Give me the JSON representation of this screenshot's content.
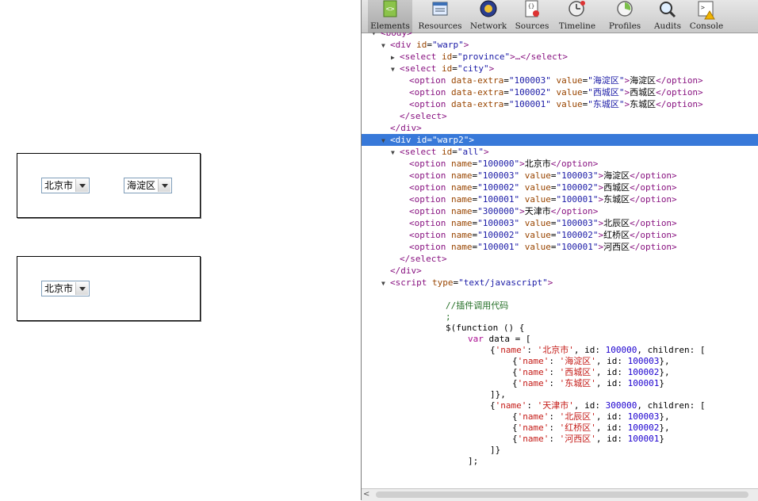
{
  "page": {
    "select1_value": "北京市",
    "select2_value": "海淀区",
    "select3_value": "北京市"
  },
  "devtools": {
    "tabs": [
      "Elements",
      "Resources",
      "Network",
      "Sources",
      "Timeline",
      "Profiles",
      "Audits",
      "Console"
    ],
    "tab_icons": [
      "elements-icon",
      "resources-icon",
      "network-icon",
      "sources-icon",
      "timeline-icon",
      "profiles-icon",
      "audits-icon",
      "console-icon"
    ],
    "active_tab": "Elements"
  },
  "dom_tree": [
    {
      "indent": 0,
      "tri": "▾",
      "kind": "tag",
      "open": "<body>"
    },
    {
      "indent": 1,
      "tri": "▼",
      "kind": "tag",
      "tag": "div",
      "attrs": [
        [
          "id",
          "warp"
        ]
      ],
      "end": ">"
    },
    {
      "indent": 2,
      "tri": "▶",
      "kind": "collapsed",
      "tag": "select",
      "attrs": [
        [
          "id",
          "province"
        ]
      ],
      "rest": ">…</select>"
    },
    {
      "indent": 2,
      "tri": "▼",
      "kind": "tag",
      "tag": "select",
      "attrs": [
        [
          "id",
          "city"
        ]
      ],
      "end": ">"
    },
    {
      "indent": 3,
      "tri": "",
      "kind": "elem",
      "tag": "option",
      "attrs": [
        [
          "data-extra",
          "100003"
        ],
        [
          "value",
          "海淀区"
        ]
      ],
      "text": "海淀区"
    },
    {
      "indent": 3,
      "tri": "",
      "kind": "elem",
      "tag": "option",
      "attrs": [
        [
          "data-extra",
          "100002"
        ],
        [
          "value",
          "西城区"
        ]
      ],
      "text": "西城区"
    },
    {
      "indent": 3,
      "tri": "",
      "kind": "elem",
      "tag": "option",
      "attrs": [
        [
          "data-extra",
          "100001"
        ],
        [
          "value",
          "东城区"
        ]
      ],
      "text": "东城区"
    },
    {
      "indent": 2,
      "tri": "",
      "kind": "close",
      "tag": "select"
    },
    {
      "indent": 1,
      "tri": "",
      "kind": "close",
      "tag": "div"
    },
    {
      "indent": 1,
      "tri": "▼",
      "kind": "tag",
      "tag": "div",
      "attrs": [
        [
          "id",
          "warp2"
        ]
      ],
      "end": ">",
      "selected": true
    },
    {
      "indent": 2,
      "tri": "▼",
      "kind": "tag",
      "tag": "select",
      "attrs": [
        [
          "id",
          "all"
        ]
      ],
      "end": ">"
    },
    {
      "indent": 3,
      "tri": "",
      "kind": "elem",
      "tag": "option",
      "attrs": [
        [
          "name",
          "100000"
        ]
      ],
      "text": "北京市"
    },
    {
      "indent": 3,
      "tri": "",
      "kind": "elem",
      "tag": "option",
      "attrs": [
        [
          "name",
          "100003"
        ],
        [
          "value",
          "100003"
        ]
      ],
      "text": "海淀区"
    },
    {
      "indent": 3,
      "tri": "",
      "kind": "elem",
      "tag": "option",
      "attrs": [
        [
          "name",
          "100002"
        ],
        [
          "value",
          "100002"
        ]
      ],
      "text": "西城区"
    },
    {
      "indent": 3,
      "tri": "",
      "kind": "elem",
      "tag": "option",
      "attrs": [
        [
          "name",
          "100001"
        ],
        [
          "value",
          "100001"
        ]
      ],
      "text": "东城区"
    },
    {
      "indent": 3,
      "tri": "",
      "kind": "elem",
      "tag": "option",
      "attrs": [
        [
          "name",
          "300000"
        ]
      ],
      "text": "天津市"
    },
    {
      "indent": 3,
      "tri": "",
      "kind": "elem",
      "tag": "option",
      "attrs": [
        [
          "name",
          "100003"
        ],
        [
          "value",
          "100003"
        ]
      ],
      "text": "北辰区"
    },
    {
      "indent": 3,
      "tri": "",
      "kind": "elem",
      "tag": "option",
      "attrs": [
        [
          "name",
          "100002"
        ],
        [
          "value",
          "100002"
        ]
      ],
      "text": "红桥区"
    },
    {
      "indent": 3,
      "tri": "",
      "kind": "elem",
      "tag": "option",
      "attrs": [
        [
          "name",
          "100001"
        ],
        [
          "value",
          "100001"
        ]
      ],
      "text": "河西区"
    },
    {
      "indent": 2,
      "tri": "",
      "kind": "close",
      "tag": "select"
    },
    {
      "indent": 1,
      "tri": "",
      "kind": "close",
      "tag": "div"
    },
    {
      "indent": 1,
      "tri": "▼",
      "kind": "tag",
      "tag": "script",
      "attrs": [
        [
          "type",
          "text/javascript"
        ]
      ],
      "end": ">"
    }
  ],
  "script_lines": [
    {
      "indent": 6,
      "parts": [
        [
          "cm",
          "//插件调用代码"
        ]
      ]
    },
    {
      "indent": 6,
      "parts": [
        [
          "cm",
          ";"
        ]
      ]
    },
    {
      "indent": 6,
      "parts": [
        [
          "tx",
          "$(function () {"
        ]
      ]
    },
    {
      "indent": 8,
      "parts": [
        [
          "kw",
          "var"
        ],
        [
          "tx",
          " data = ["
        ]
      ]
    },
    {
      "indent": 10,
      "parts": [
        [
          "tx",
          "{"
        ],
        [
          "st",
          "'name'"
        ],
        [
          "tx",
          ": "
        ],
        [
          "st",
          "'北京市'"
        ],
        [
          "tx",
          ", id: "
        ],
        [
          "nm",
          "100000"
        ],
        [
          "tx",
          ", children: ["
        ]
      ]
    },
    {
      "indent": 12,
      "parts": [
        [
          "tx",
          "{"
        ],
        [
          "st",
          "'name'"
        ],
        [
          "tx",
          ": "
        ],
        [
          "st",
          "'海淀区'"
        ],
        [
          "tx",
          ", id: "
        ],
        [
          "nm",
          "100003"
        ],
        [
          "tx",
          "},"
        ]
      ]
    },
    {
      "indent": 12,
      "parts": [
        [
          "tx",
          "{"
        ],
        [
          "st",
          "'name'"
        ],
        [
          "tx",
          ": "
        ],
        [
          "st",
          "'西城区'"
        ],
        [
          "tx",
          ", id: "
        ],
        [
          "nm",
          "100002"
        ],
        [
          "tx",
          "},"
        ]
      ]
    },
    {
      "indent": 12,
      "parts": [
        [
          "tx",
          "{"
        ],
        [
          "st",
          "'name'"
        ],
        [
          "tx",
          ": "
        ],
        [
          "st",
          "'东城区'"
        ],
        [
          "tx",
          ", id: "
        ],
        [
          "nm",
          "100001"
        ],
        [
          "tx",
          "}"
        ]
      ]
    },
    {
      "indent": 10,
      "parts": [
        [
          "tx",
          "]},"
        ]
      ]
    },
    {
      "indent": 10,
      "parts": [
        [
          "tx",
          "{"
        ],
        [
          "st",
          "'name'"
        ],
        [
          "tx",
          ": "
        ],
        [
          "st",
          "'天津市'"
        ],
        [
          "tx",
          ", id: "
        ],
        [
          "nm",
          "300000"
        ],
        [
          "tx",
          ", children: ["
        ]
      ]
    },
    {
      "indent": 12,
      "parts": [
        [
          "tx",
          "{"
        ],
        [
          "st",
          "'name'"
        ],
        [
          "tx",
          ": "
        ],
        [
          "st",
          "'北辰区'"
        ],
        [
          "tx",
          ", id: "
        ],
        [
          "nm",
          "100003"
        ],
        [
          "tx",
          "},"
        ]
      ]
    },
    {
      "indent": 12,
      "parts": [
        [
          "tx",
          "{"
        ],
        [
          "st",
          "'name'"
        ],
        [
          "tx",
          ": "
        ],
        [
          "st",
          "'红桥区'"
        ],
        [
          "tx",
          ", id: "
        ],
        [
          "nm",
          "100002"
        ],
        [
          "tx",
          "},"
        ]
      ]
    },
    {
      "indent": 12,
      "parts": [
        [
          "tx",
          "{"
        ],
        [
          "st",
          "'name'"
        ],
        [
          "tx",
          ": "
        ],
        [
          "st",
          "'河西区'"
        ],
        [
          "tx",
          ", id: "
        ],
        [
          "nm",
          "100001"
        ],
        [
          "tx",
          "}"
        ]
      ]
    },
    {
      "indent": 10,
      "parts": [
        [
          "tx",
          "]}"
        ]
      ]
    },
    {
      "indent": 8,
      "parts": [
        [
          "tx",
          "];"
        ]
      ]
    }
  ]
}
